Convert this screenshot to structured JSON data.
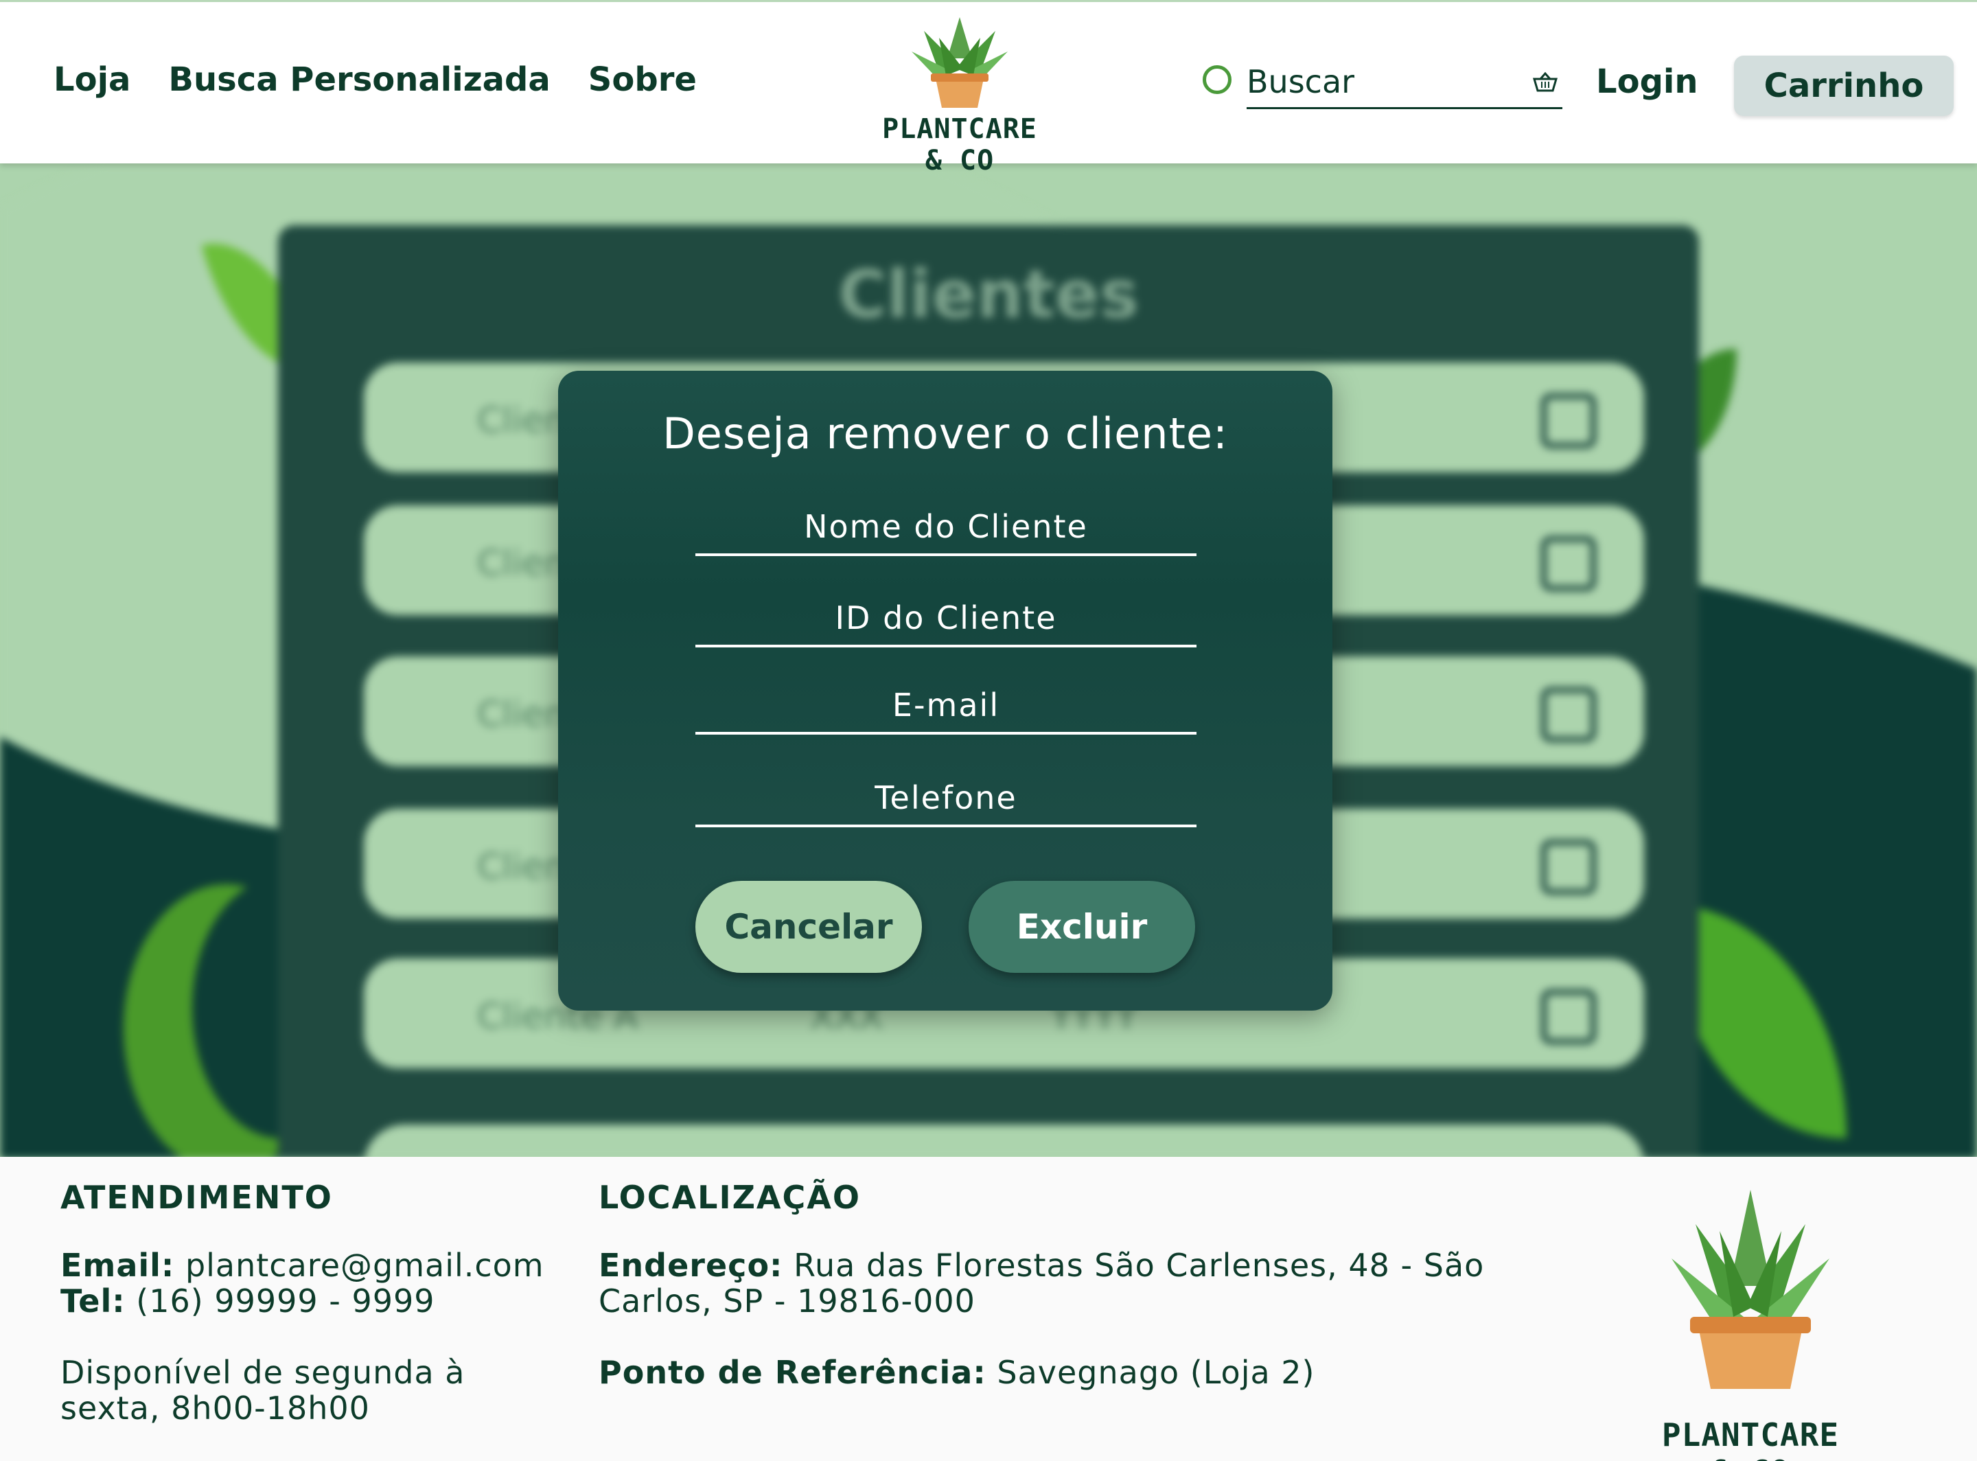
{
  "header": {
    "nav": [
      "Loja",
      "Busca Personalizada",
      "Sobre"
    ],
    "logo_text": "PLANTCARE & CO",
    "search_placeholder": "Buscar",
    "login_label": "Login",
    "cart_label": "Carrinho"
  },
  "background": {
    "panel_title": "Clientes",
    "row_label": "Cliente A",
    "row_values": [
      "XXX",
      "YYYY"
    ]
  },
  "modal": {
    "title": "Deseja remover o cliente:",
    "fields": [
      "Nome do Cliente",
      "ID do Cliente",
      "E-mail",
      "Telefone"
    ],
    "cancel_label": "Cancelar",
    "delete_label": "Excluir"
  },
  "footer": {
    "atendimento": {
      "heading": "ATENDIMENTO",
      "email_label": "Email:",
      "email": "plantcare@gmail.com",
      "tel_label": "Tel:",
      "tel": "(16) 99999 - 9999",
      "hours_line1": "Disponível de segunda à",
      "hours_line2": "sexta, 8h00-18h00"
    },
    "localizacao": {
      "heading": "LOCALIZAÇÃO",
      "address_label": "Endereço:",
      "address_line1": "Rua das Florestas São Carlenses, 48   - São",
      "address_line2": "Carlos, SP - 19816-000",
      "ref_label": "Ponto de Referência:",
      "ref": "Savegnago (Loja 2)"
    },
    "logo_text": "PLANTCARE & CO"
  },
  "colors": {
    "dark_green": "#0d3b2a",
    "teal": "#1e4a40",
    "light_green": "#acd4ad",
    "accent": "#3e7a68"
  }
}
